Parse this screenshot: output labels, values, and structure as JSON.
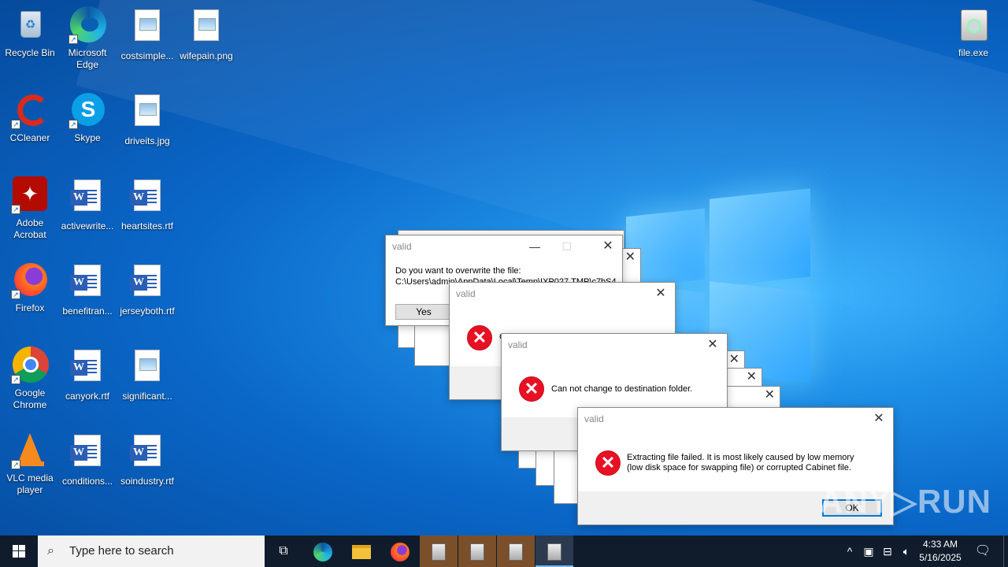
{
  "desktop_icons": [
    {
      "label": "Recycle Bin"
    },
    {
      "label": "Microsoft Edge"
    },
    {
      "label": "costsimple..."
    },
    {
      "label": "wifepain.png"
    },
    {
      "label": "CCleaner"
    },
    {
      "label": "Skype"
    },
    {
      "label": "driveits.jpg"
    },
    {
      "label": "Adobe Acrobat"
    },
    {
      "label": "activewrite..."
    },
    {
      "label": "heartsites.rtf"
    },
    {
      "label": "Firefox"
    },
    {
      "label": "benefitran..."
    },
    {
      "label": "jerseyboth.rtf"
    },
    {
      "label": "Google Chrome"
    },
    {
      "label": "canyork.rtf"
    },
    {
      "label": "significant..."
    },
    {
      "label": "VLC media player"
    },
    {
      "label": "conditions..."
    },
    {
      "label": "soindustry.rtf"
    },
    {
      "label": "file.exe"
    }
  ],
  "dialogs": {
    "overwrite": {
      "title": "valid",
      "message_line1": "Do you want to overwrite the file:",
      "message_line2": "C:\\Users\\admin\\AppData\\Local\\Temp\\IXP027.TMP\\c7bS4",
      "yes_label": "Yes"
    },
    "second": {
      "title": "valid",
      "message": "C"
    },
    "dest_folder": {
      "title": "valid",
      "message": "Can not change to destination folder."
    },
    "extract_failed": {
      "title": "valid",
      "message_line1": "Extracting file failed.  It is most likely caused by low memory",
      "message_line2": "(low disk space for swapping file) or corrupted Cabinet file.",
      "ok_label": "OK"
    }
  },
  "taskbar": {
    "search_placeholder": "Type here to search",
    "time": "4:33 AM",
    "date": "5/16/2025"
  },
  "watermark": "ANY▷RUN"
}
